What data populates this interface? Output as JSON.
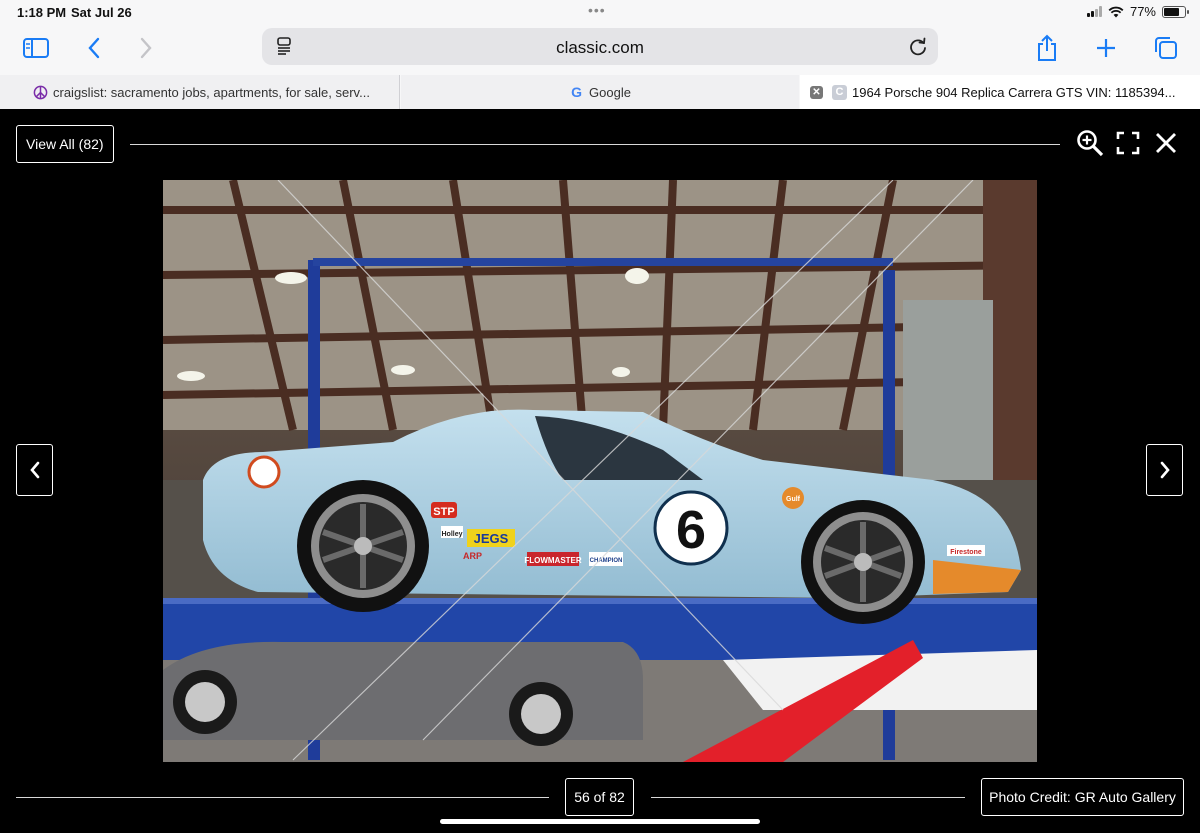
{
  "status_bar": {
    "time": "1:18 PM",
    "date": "Sat Jul 26",
    "battery_percent": "77%",
    "battery_level": 0.77
  },
  "toolbar": {
    "url": "classic.com"
  },
  "tabs": [
    {
      "title": "craigslist: sacramento jobs, apartments, for sale, serv...",
      "favicon": "peace-icon",
      "active": false
    },
    {
      "title": "Google",
      "favicon": "google-g-icon",
      "active": false
    },
    {
      "title": "1964 Porsche 904 Replica Carrera GTS VIN: 1185394...",
      "favicon": "classic-c-icon",
      "active": true
    }
  ],
  "gallery": {
    "view_all_label": "View All (82)",
    "counter": "56 of 82",
    "photo_credit": "Photo Credit: GR Auto Gallery"
  },
  "photo": {
    "car_number": "6",
    "decals": [
      "STP",
      "Holley",
      "JEGS",
      "FLOWMASTER",
      "CHAMPION",
      "ARP",
      "Gulf",
      "Firestone"
    ]
  },
  "colors": {
    "safari_blue": "#1a7cf5",
    "car_body": "#a9cfe3",
    "car_accent": "#e58a2b",
    "lift_blue": "#1f3c9a"
  }
}
